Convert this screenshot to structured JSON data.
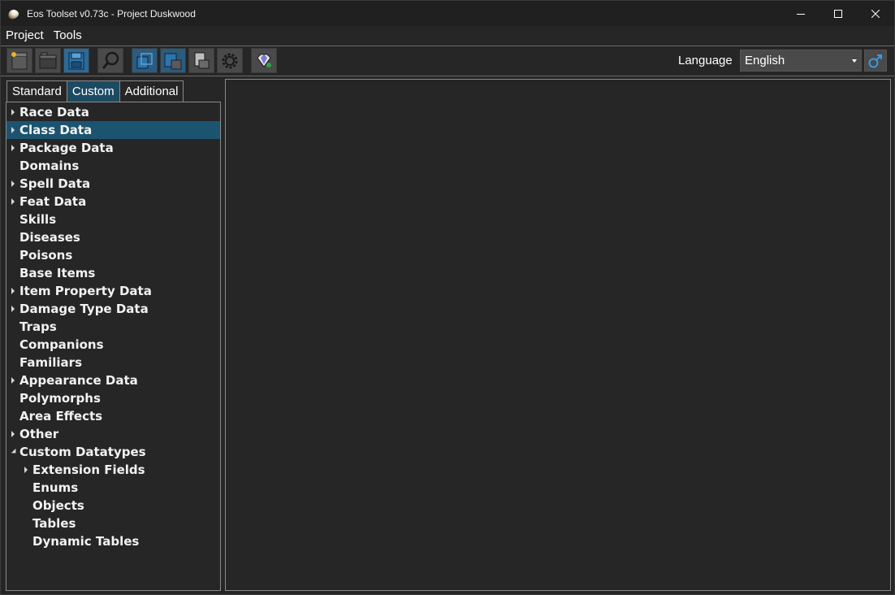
{
  "window": {
    "title": "Eos Toolset v0.73c - Project Duskwood"
  },
  "menu": {
    "items": [
      "Project",
      "Tools"
    ]
  },
  "toolbar": {
    "buttons": [
      {
        "name": "new-project-icon"
      },
      {
        "name": "open-project-icon"
      },
      {
        "name": "save-project-icon"
      },
      {
        "name": "search-icon"
      },
      {
        "name": "export-icon"
      },
      {
        "name": "save-all-icon"
      },
      {
        "name": "document-print-icon"
      },
      {
        "name": "settings-gear-icon"
      },
      {
        "name": "gem-icon"
      }
    ],
    "language_label": "Language",
    "language_value": "English",
    "gender_icon": "male-symbol-icon",
    "accent": "#1c4a63"
  },
  "tabs": [
    "Standard",
    "Custom",
    "Additional"
  ],
  "active_tab": "Custom",
  "tree": [
    {
      "label": "Race Data",
      "level": 0,
      "arrow": "collapsed"
    },
    {
      "label": "Class Data",
      "level": 0,
      "arrow": "collapsed",
      "selected": true
    },
    {
      "label": "Package Data",
      "level": 0,
      "arrow": "collapsed"
    },
    {
      "label": "Domains",
      "level": 0,
      "arrow": ""
    },
    {
      "label": "Spell Data",
      "level": 0,
      "arrow": "collapsed"
    },
    {
      "label": "Feat Data",
      "level": 0,
      "arrow": "collapsed"
    },
    {
      "label": "Skills",
      "level": 0,
      "arrow": ""
    },
    {
      "label": "Diseases",
      "level": 0,
      "arrow": ""
    },
    {
      "label": "Poisons",
      "level": 0,
      "arrow": ""
    },
    {
      "label": "Base Items",
      "level": 0,
      "arrow": ""
    },
    {
      "label": "Item Property Data",
      "level": 0,
      "arrow": "collapsed"
    },
    {
      "label": "Damage Type Data",
      "level": 0,
      "arrow": "collapsed"
    },
    {
      "label": "Traps",
      "level": 0,
      "arrow": ""
    },
    {
      "label": "Companions",
      "level": 0,
      "arrow": ""
    },
    {
      "label": "Familiars",
      "level": 0,
      "arrow": ""
    },
    {
      "label": "Appearance Data",
      "level": 0,
      "arrow": "collapsed"
    },
    {
      "label": "Polymorphs",
      "level": 0,
      "arrow": ""
    },
    {
      "label": "Area Effects",
      "level": 0,
      "arrow": ""
    },
    {
      "label": "Other",
      "level": 0,
      "arrow": "collapsed"
    },
    {
      "label": "Custom Datatypes",
      "level": 0,
      "arrow": "expanded"
    },
    {
      "label": "Extension Fields",
      "level": 1,
      "arrow": "collapsed"
    },
    {
      "label": "Enums",
      "level": 1,
      "arrow": ""
    },
    {
      "label": "Objects",
      "level": 1,
      "arrow": ""
    },
    {
      "label": "Tables",
      "level": 1,
      "arrow": ""
    },
    {
      "label": "Dynamic Tables",
      "level": 1,
      "arrow": ""
    }
  ]
}
